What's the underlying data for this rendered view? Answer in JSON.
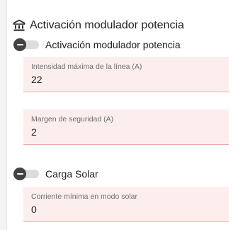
{
  "section": {
    "title": "Activación modulador potencia",
    "icon": "bank-building-icon"
  },
  "toggles": [
    {
      "label": "Activación modulador potencia",
      "state": "off"
    },
    {
      "label": "Carga Solar",
      "state": "off"
    }
  ],
  "fields": [
    {
      "label": "Intensidad máxima de la línea (A)",
      "value": "22"
    },
    {
      "label": "Margen de seguridad (A)",
      "value": "2"
    },
    {
      "label": "Corriente mínima en modo solar",
      "value": "0"
    }
  ],
  "colors": {
    "field_background": "#fdeeee",
    "field_underline": "#e8a9a9",
    "toggle_thumb": "#424242",
    "toggle_track": "#dcdcdc",
    "text": "#212121",
    "label_text": "#6d6d6d"
  }
}
